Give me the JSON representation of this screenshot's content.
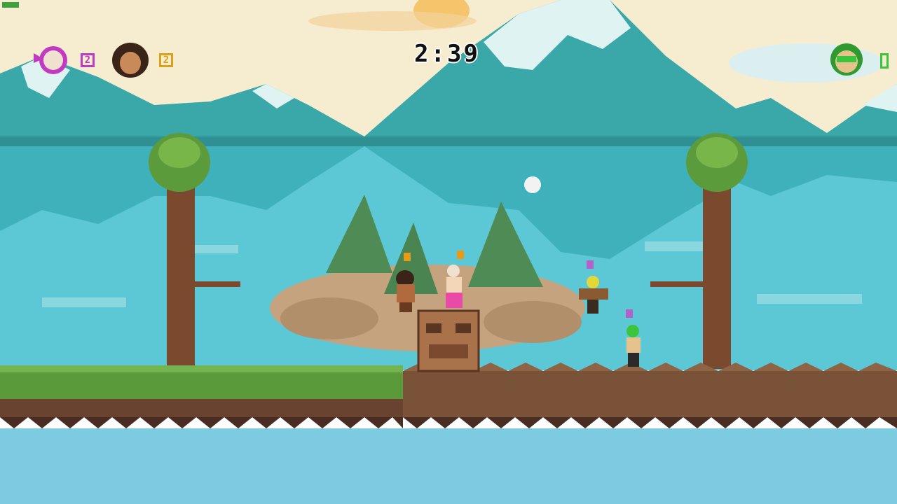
{
  "hud": {
    "timer": "2:39",
    "players": [
      {
        "name": "pink-masked-wrestler",
        "score": "2",
        "color": "#c23ac2",
        "side": "left"
      },
      {
        "name": "caveman-wrestler",
        "score": "2",
        "color": "#d9a21b",
        "side": "left"
      },
      {
        "name": "green-masked-wrestler",
        "score": "0",
        "color": "#3cc53c",
        "side": "right"
      }
    ]
  },
  "scene": {
    "sky_color": "#f6ecd0",
    "mountain_color": "#3aa7a8",
    "lake_color": "#5cc8d6",
    "grass_color": "#5a9a3a",
    "rock_color": "#7a5238",
    "characters": [
      {
        "name": "caveman-fighter",
        "marker_color": "#e79b1a"
      },
      {
        "name": "pink-wrestler-fighter",
        "marker_color": "#e79b1a"
      },
      {
        "name": "yellow-masked-fighter",
        "marker_color": "#b360c9"
      },
      {
        "name": "green-masked-fighter",
        "marker_color": "#b360c9"
      }
    ]
  }
}
